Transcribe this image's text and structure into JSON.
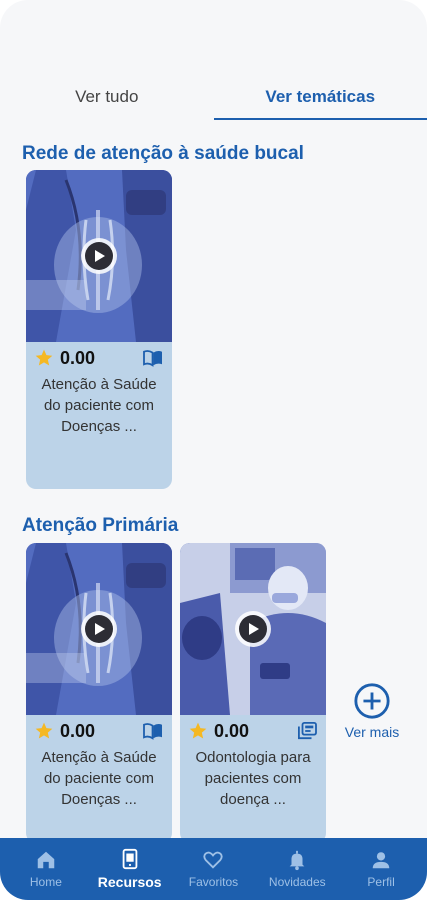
{
  "tabs": [
    {
      "label": "Ver tudo",
      "active": false
    },
    {
      "label": "Ver temáticas",
      "active": true
    }
  ],
  "sections": [
    {
      "title": "Rede de atenção à saúde bucal",
      "cards": [
        {
          "rating": "0.00",
          "title": "Atenção à Saúde do paciente com Doenças ...",
          "type_icon": "book-icon",
          "thumbnail": "doctor-lungs"
        }
      ]
    },
    {
      "title": "Atenção Primária",
      "cards": [
        {
          "rating": "0.00",
          "title": "Atenção à Saúde do paciente com Doenças ...",
          "type_icon": "book-icon",
          "thumbnail": "doctor-lungs"
        },
        {
          "rating": "0.00",
          "title": "Odontologia para pacientes com doença ...",
          "type_icon": "collection-icon",
          "thumbnail": "dentist-patient"
        }
      ],
      "see_more_label": "Ver mais"
    }
  ],
  "bottom_nav": [
    {
      "label": "Home",
      "icon": "home-icon",
      "active": false
    },
    {
      "label": "Recursos",
      "icon": "tablet-icon",
      "active": true
    },
    {
      "label": "Favoritos",
      "icon": "heart-icon",
      "active": false
    },
    {
      "label": "Novidades",
      "icon": "bell-icon",
      "active": false
    },
    {
      "label": "Perfil",
      "icon": "person-icon",
      "active": false
    }
  ],
  "colors": {
    "primary": "#1d5fae",
    "card_bg": "#bcd3e8",
    "star": "#f5b823",
    "nav_inactive": "#9ec0e6"
  }
}
